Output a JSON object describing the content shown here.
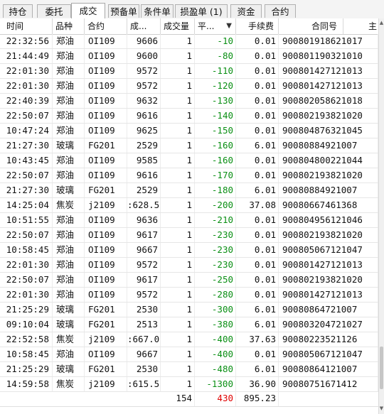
{
  "tabs": [
    {
      "label": "持仓"
    },
    {
      "label": "委托"
    },
    {
      "label": "成交",
      "active": true
    },
    {
      "label": "预备单"
    },
    {
      "label": "条件单"
    },
    {
      "label": "损盈单 (1)"
    },
    {
      "label": "资金"
    },
    {
      "label": "合约"
    }
  ],
  "columns": [
    "时间",
    "品种",
    "合约",
    "成...",
    "成交量",
    "平...",
    "手续费",
    "合同号",
    "主"
  ],
  "rows": [
    {
      "time": "22:32:56",
      "product": "郑油",
      "contract": "OI109",
      "price": "9606",
      "qty": "1",
      "pnl": "-10",
      "fee": "0.01",
      "order_no": "900801918621017"
    },
    {
      "time": "21:44:49",
      "product": "郑油",
      "contract": "OI109",
      "price": "9600",
      "qty": "1",
      "pnl": "-80",
      "fee": "0.01",
      "order_no": "900801190321010"
    },
    {
      "time": "22:01:30",
      "product": "郑油",
      "contract": "OI109",
      "price": "9572",
      "qty": "1",
      "pnl": "-110",
      "fee": "0.01",
      "order_no": "900801427121013"
    },
    {
      "time": "22:01:30",
      "product": "郑油",
      "contract": "OI109",
      "price": "9572",
      "qty": "1",
      "pnl": "-120",
      "fee": "0.01",
      "order_no": "900801427121013"
    },
    {
      "time": "22:40:39",
      "product": "郑油",
      "contract": "OI109",
      "price": "9632",
      "qty": "1",
      "pnl": "-130",
      "fee": "0.01",
      "order_no": "900802058621018"
    },
    {
      "time": "22:50:07",
      "product": "郑油",
      "contract": "OI109",
      "price": "9616",
      "qty": "1",
      "pnl": "-140",
      "fee": "0.01",
      "order_no": "900802193821020"
    },
    {
      "time": "10:47:24",
      "product": "郑油",
      "contract": "OI109",
      "price": "9625",
      "qty": "1",
      "pnl": "-150",
      "fee": "0.01",
      "order_no": "900804876321045"
    },
    {
      "time": "21:27:30",
      "product": "玻璃",
      "contract": "FG201",
      "price": "2529",
      "qty": "1",
      "pnl": "-160",
      "fee": "6.01",
      "order_no": "90080884921007"
    },
    {
      "time": "10:43:45",
      "product": "郑油",
      "contract": "OI109",
      "price": "9585",
      "qty": "1",
      "pnl": "-160",
      "fee": "0.01",
      "order_no": "900804800221044"
    },
    {
      "time": "22:50:07",
      "product": "郑油",
      "contract": "OI109",
      "price": "9616",
      "qty": "1",
      "pnl": "-170",
      "fee": "0.01",
      "order_no": "900802193821020"
    },
    {
      "time": "21:27:30",
      "product": "玻璃",
      "contract": "FG201",
      "price": "2529",
      "qty": "1",
      "pnl": "-180",
      "fee": "6.01",
      "order_no": "90080884921007"
    },
    {
      "time": "14:25:04",
      "product": "焦炭",
      "contract": "j2109",
      "price": ":628.5",
      "qty": "1",
      "pnl": "-200",
      "fee": "37.08",
      "order_no": "90080667461368"
    },
    {
      "time": "10:51:55",
      "product": "郑油",
      "contract": "OI109",
      "price": "9636",
      "qty": "1",
      "pnl": "-210",
      "fee": "0.01",
      "order_no": "900804956121046"
    },
    {
      "time": "22:50:07",
      "product": "郑油",
      "contract": "OI109",
      "price": "9617",
      "qty": "1",
      "pnl": "-230",
      "fee": "0.01",
      "order_no": "900802193821020"
    },
    {
      "time": "10:58:45",
      "product": "郑油",
      "contract": "OI109",
      "price": "9667",
      "qty": "1",
      "pnl": "-230",
      "fee": "0.01",
      "order_no": "900805067121047"
    },
    {
      "time": "22:01:30",
      "product": "郑油",
      "contract": "OI109",
      "price": "9572",
      "qty": "1",
      "pnl": "-230",
      "fee": "0.01",
      "order_no": "900801427121013"
    },
    {
      "time": "22:50:07",
      "product": "郑油",
      "contract": "OI109",
      "price": "9617",
      "qty": "1",
      "pnl": "-250",
      "fee": "0.01",
      "order_no": "900802193821020"
    },
    {
      "time": "22:01:30",
      "product": "郑油",
      "contract": "OI109",
      "price": "9572",
      "qty": "1",
      "pnl": "-280",
      "fee": "0.01",
      "order_no": "900801427121013"
    },
    {
      "time": "21:25:29",
      "product": "玻璃",
      "contract": "FG201",
      "price": "2530",
      "qty": "1",
      "pnl": "-300",
      "fee": "6.01",
      "order_no": "90080864721007"
    },
    {
      "time": "09:10:04",
      "product": "玻璃",
      "contract": "FG201",
      "price": "2513",
      "qty": "1",
      "pnl": "-380",
      "fee": "6.01",
      "order_no": "900803204721027"
    },
    {
      "time": "22:52:58",
      "product": "焦炭",
      "contract": "j2109",
      "price": ":667.0",
      "qty": "1",
      "pnl": "-400",
      "fee": "37.63",
      "order_no": "90080223521126"
    },
    {
      "time": "10:58:45",
      "product": "郑油",
      "contract": "OI109",
      "price": "9667",
      "qty": "1",
      "pnl": "-400",
      "fee": "0.01",
      "order_no": "900805067121047"
    },
    {
      "time": "21:25:29",
      "product": "玻璃",
      "contract": "FG201",
      "price": "2530",
      "qty": "1",
      "pnl": "-480",
      "fee": "6.01",
      "order_no": "90080864121007"
    },
    {
      "time": "14:59:58",
      "product": "焦炭",
      "contract": "j2109",
      "price": ":615.5",
      "qty": "1",
      "pnl": "-1300",
      "fee": "36.90",
      "order_no": "90080751671412"
    }
  ],
  "totals": {
    "qty": "154",
    "pnl": "430",
    "fee": "895.23"
  },
  "colors": {
    "negative": "#0a8f14",
    "positive": "#e00000"
  }
}
